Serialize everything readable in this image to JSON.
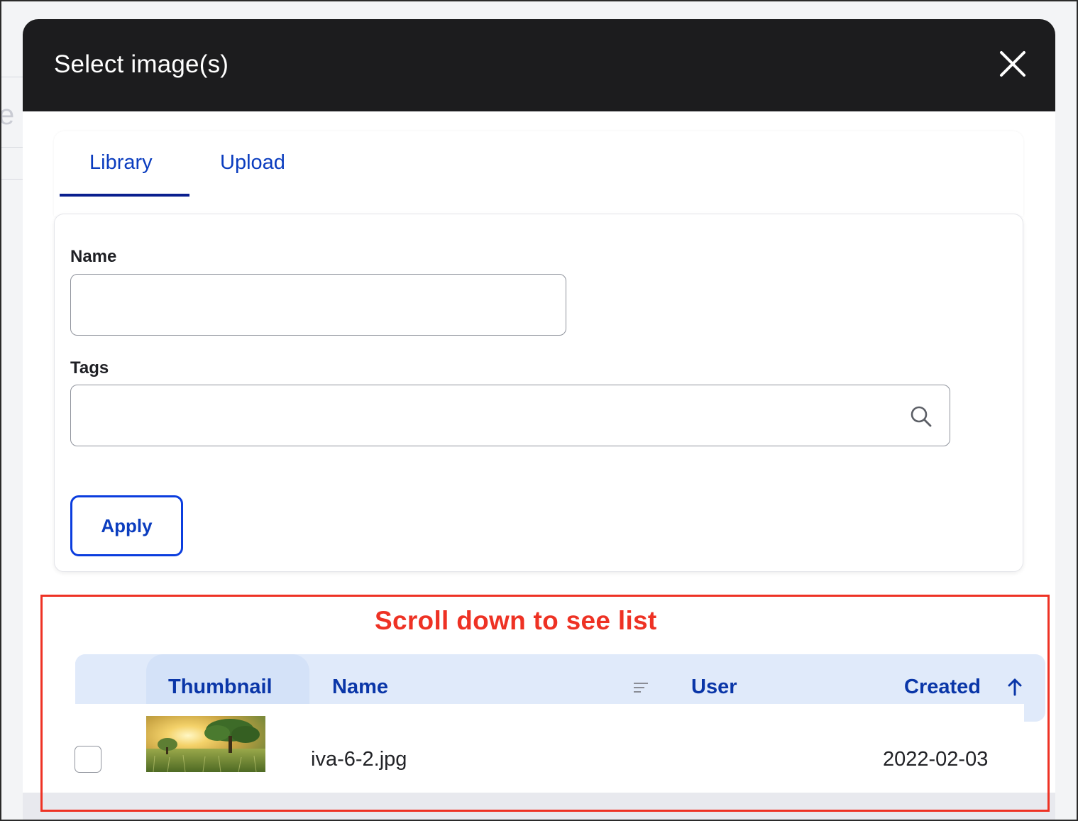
{
  "dialog": {
    "title": "Select image(s)",
    "close_icon": "close-icon"
  },
  "tabs": [
    {
      "label": "Library",
      "active": true
    },
    {
      "label": "Upload",
      "active": false
    }
  ],
  "filters": {
    "name_label": "Name",
    "name_value": "",
    "tags_label": "Tags",
    "tags_value": "",
    "tags_icon": "search-icon",
    "apply_label": "Apply"
  },
  "annotation": {
    "text": "Scroll down to see list",
    "color": "#ee3224"
  },
  "table": {
    "columns": [
      "Thumbnail",
      "Name",
      "User",
      "Created"
    ],
    "sorted_column": "Created",
    "sort_direction": "ascending",
    "rows": [
      {
        "checked": false,
        "thumbnail": "tree-in-field-image",
        "name": "iva-6-2.jpg",
        "user": "",
        "created": "2022-02-03"
      }
    ]
  },
  "colors": {
    "header_bg": "#1c1c1e",
    "link_blue": "#0b3dbf",
    "table_header_bg": "#e0eafa"
  }
}
